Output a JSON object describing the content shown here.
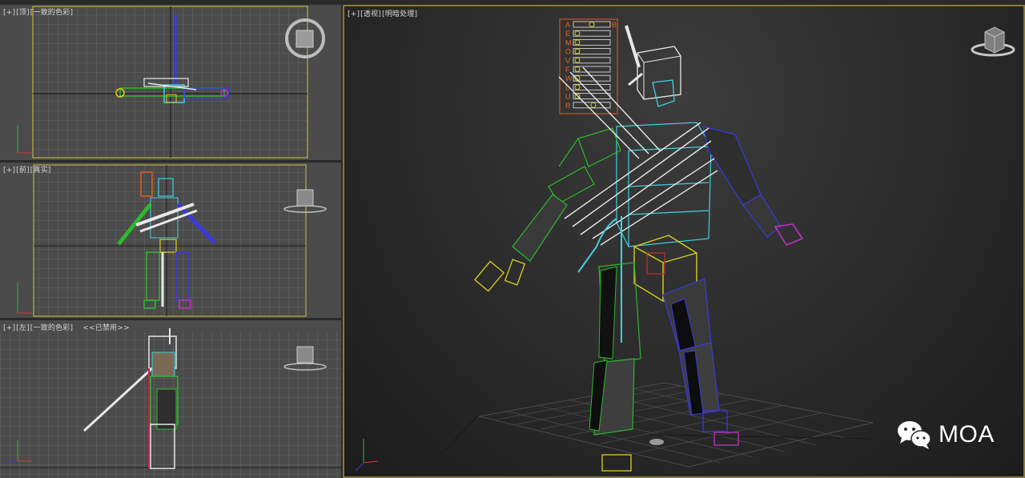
{
  "viewports": {
    "top": {
      "label_plus": "[+]",
      "label_view": "[顶]",
      "label_shading": "[一致的色彩]"
    },
    "front": {
      "label_plus": "[+]",
      "label_view": "[前]",
      "label_shading": "[真实]"
    },
    "left": {
      "label_plus": "[+]",
      "label_view": "[左]",
      "label_shading": "[一致的色彩]",
      "label_extra": "<<已禁用>>"
    },
    "perspective": {
      "label_plus": "[+]",
      "label_view": "[透视]",
      "label_shading": "[明暗处理]"
    }
  },
  "face_panel": {
    "letters": [
      "A",
      "E",
      "M",
      "O",
      "V",
      "F",
      "W",
      "L",
      "U",
      "R"
    ],
    "right_letter": "B"
  },
  "watermark": {
    "text": "MOA"
  },
  "colors": {
    "viewport_bg": "#4b4b4b",
    "grid": "#6a6a6a",
    "active_border": "#d2c23c",
    "bone_green": "#2db82d",
    "bone_blue": "#3a3ae0",
    "bone_cyan": "#40d0e0",
    "bone_yellow": "#d8d020",
    "bone_magenta": "#c030c0",
    "bone_white": "#e8e8e8"
  },
  "icons": [
    "viewcube-icon",
    "wechat-icon",
    "axis-tripod-icon"
  ]
}
